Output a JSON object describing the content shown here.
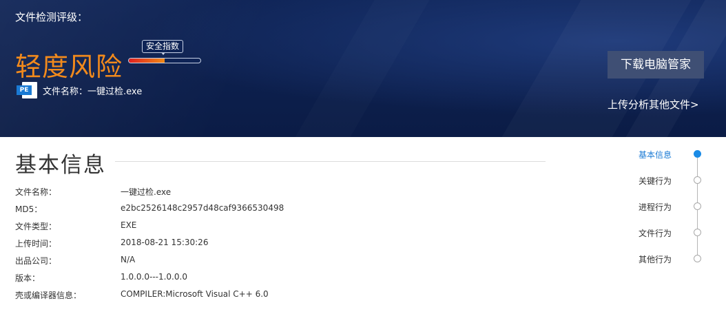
{
  "header": {
    "eval_title": "文件检测评级：",
    "risk_level": "轻度风险",
    "safety_index": {
      "label": "安全指数",
      "level_percent": 50
    },
    "file_name_label": "文件名称：",
    "file_name": "一键过检.exe",
    "file_icon": "pe-file-icon",
    "file_icon_text": "PE",
    "download_button": "下载电脑管家",
    "upload_link": "上传分析其他文件>"
  },
  "section": {
    "title": "基本信息"
  },
  "info": [
    {
      "key": "文件名称：",
      "value": "一键过检.exe"
    },
    {
      "key": "MD5：",
      "value": "e2bc2526148c2957d48caf9366530498"
    },
    {
      "key": "文件类型：",
      "value": "EXE"
    },
    {
      "key": "上传时间：",
      "value": "2018-08-21 15:30:26"
    },
    {
      "key": "出品公司：",
      "value": "N/A"
    },
    {
      "key": "版本：",
      "value": "1.0.0.0---1.0.0.0"
    },
    {
      "key": "壳或编译器信息：",
      "value": "COMPILER:Microsoft Visual C++ 6.0"
    }
  ],
  "side_nav": [
    {
      "label": "基本信息",
      "active": true
    },
    {
      "label": "关键行为",
      "active": false
    },
    {
      "label": "进程行为",
      "active": false
    },
    {
      "label": "文件行为",
      "active": false
    },
    {
      "label": "其他行为",
      "active": false
    }
  ],
  "colors": {
    "banner_bg": "#0f2456",
    "risk_orange": "#f28a1c",
    "accent_blue": "#1a7ad4",
    "button_bg": "#3f4f74"
  }
}
